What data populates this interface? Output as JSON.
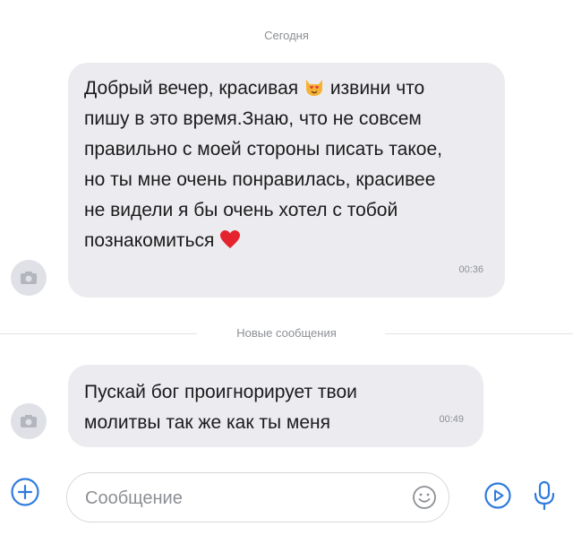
{
  "chat": {
    "date_separator": "Сегодня",
    "new_messages_separator": "Новые сообщения",
    "messages": [
      {
        "text_part1": "Добрый вечер, красивая",
        "emoji1": "heart-eyes-cat-emoji",
        "text_part2": "извини что пишу в это время.Знаю, что не совсем правильно с моей стороны писать такое, но ты мне очень понравилась, красивее не видели я бы очень хотел с тобой познакомиться",
        "emoji2": "red-heart-emoji",
        "time": "00:36"
      },
      {
        "text": "Пускай бог проигнорирует твои молитвы так же как ты меня",
        "time": "00:49"
      }
    ]
  },
  "composer": {
    "placeholder": "Сообщение"
  },
  "icons": {
    "add": "plus-circle-icon",
    "smile": "smile-icon",
    "gif": "play-circle-icon",
    "mic": "microphone-icon",
    "avatar": "camera-icon"
  },
  "colors": {
    "bubble": "#ececf0",
    "accent": "#2f7bde",
    "muted_text": "#8c8f94"
  }
}
